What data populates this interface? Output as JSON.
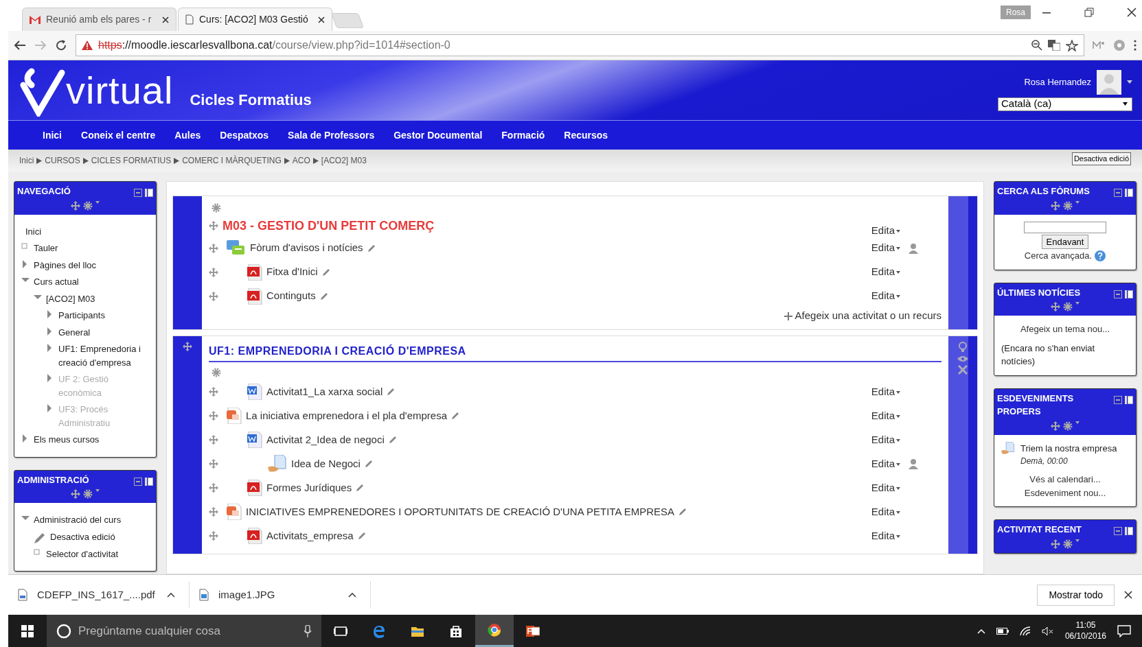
{
  "browser": {
    "tabs": [
      {
        "title": "Reunió amb els pares - r",
        "kind": "mail",
        "selected": false
      },
      {
        "title": "Curs: [ACO2] M03 Gestió",
        "kind": "page",
        "selected": true
      }
    ],
    "profile": "Rosa",
    "url_scheme": "https",
    "url_rest": "://moodle.iescarlesvallbona.cat",
    "url_path": "/course/view.php?id=1014#section-0"
  },
  "site": {
    "logo": "virtual",
    "subtitle": "Cicles Formatius",
    "user": "Rosa Hernandez",
    "language": "Català (ca)",
    "menu": [
      "Inici",
      "Coneix el centre",
      "Aules",
      "Despatxos",
      "Sala de Professors",
      "Gestor Documental",
      "Formació",
      "Recursos"
    ],
    "breadcrumb": [
      "Inici",
      "CURSOS",
      "CICLES FORMATIUS",
      "COMERC I MÀRQUETING",
      "ACO",
      "[ACO2] M03"
    ],
    "edit_button": "Desactiva edició"
  },
  "left_blocks": [
    {
      "title": "NAVEGACIÓ",
      "items": [
        {
          "label": "Inici",
          "kind": "home",
          "dimmed": false
        },
        {
          "label": "Tauler",
          "kind": "leaf",
          "dimmed": false
        },
        {
          "label": "Pàgines del lloc",
          "kind": "branch",
          "expanded": false,
          "dimmed": false
        },
        {
          "label": "Curs actual",
          "kind": "branch",
          "expanded": true,
          "dimmed": false,
          "children": [
            {
              "label": "[ACO2] M03",
              "kind": "branch",
              "expanded": true,
              "dimmed": false,
              "children": [
                {
                  "label": "Participants",
                  "kind": "branch",
                  "expanded": false,
                  "dimmed": false
                },
                {
                  "label": "General",
                  "kind": "branch",
                  "expanded": false,
                  "dimmed": false
                },
                {
                  "label": "UF1: Emprenedoria i creació d'empresa",
                  "kind": "branch",
                  "expanded": false,
                  "dimmed": false
                },
                {
                  "label": "UF 2: Gestió econòmica",
                  "kind": "branch",
                  "expanded": false,
                  "dimmed": true
                },
                {
                  "label": "UF3: Procés Administratiu",
                  "kind": "branch",
                  "expanded": false,
                  "dimmed": true
                }
              ]
            }
          ]
        },
        {
          "label": "Els meus cursos",
          "kind": "branch",
          "expanded": false,
          "dimmed": false
        }
      ]
    },
    {
      "title": "ADMINISTRACIÓ",
      "items": [
        {
          "label": "Administració del curs",
          "kind": "branch",
          "expanded": true,
          "dimmed": false,
          "children": [
            {
              "label": "Desactiva edició",
              "kind": "edit",
              "dimmed": false
            },
            {
              "label": "Selector d'activitat",
              "kind": "leaf",
              "dimmed": false
            }
          ]
        }
      ]
    }
  ],
  "sections": [
    {
      "kind": "general",
      "title": "M03 - GESTIO D'UN PETIT COMERÇ",
      "title_action": "Edita",
      "add_link": "Afegeix una activitat o un recurs",
      "activities": [
        {
          "name": "Fòrum d'avisos i notícies",
          "kind": "forum",
          "action": "Edita",
          "groups": true,
          "indented": false,
          "children": [
            {
              "name": "Fitxa d'Inici",
              "kind": "pdf",
              "action": "Edita",
              "groups": false,
              "indented": false
            },
            {
              "name": "Continguts",
              "kind": "pdf",
              "action": "Edita",
              "groups": false,
              "indented": false
            }
          ]
        }
      ]
    },
    {
      "kind": "topic",
      "title": "UF1: EMPRENEDORIA I CREACIÓ D'EMPRESA",
      "activities": [
        {
          "name": "Activitat1_La xarxa social",
          "kind": "word",
          "action": "Edita",
          "groups": false,
          "indented": true
        },
        {
          "name": "La iniciativa emprenedora i el pla d'empresa",
          "kind": "powerpoint",
          "action": "Edita",
          "groups": false,
          "indented": false,
          "children": [
            {
              "name": "Activitat 2_Idea de negoci",
              "kind": "word",
              "action": "Edita",
              "groups": false,
              "indented": false,
              "children": [
                {
                  "name": "Idea de Negoci",
                  "kind": "assign",
                  "action": "Edita",
                  "groups": true,
                  "indented": false
                }
              ]
            },
            {
              "name": "Formes Jurídiques",
              "kind": "pdf",
              "action": "Edita",
              "groups": false,
              "indented": false
            }
          ]
        },
        {
          "name": "INICIATIVES EMPRENEDORES I OPORTUNITATS DE CREACIÓ D'UNA PETITA EMPRESA",
          "kind": "powerpoint",
          "action": "Edita",
          "groups": false,
          "indented": false,
          "children": [
            {
              "name": "Activitats_empresa",
              "kind": "pdf",
              "action": "Edita",
              "groups": false,
              "indented": false
            }
          ]
        }
      ]
    }
  ],
  "right_blocks": [
    {
      "kind": "search",
      "title": "CERCA ALS FÒRUMS",
      "button": "Endavant",
      "link": "Cerca avançada."
    },
    {
      "kind": "news",
      "title": "ÚLTIMES NOTÍCIES",
      "link": "Afegeix un tema nou...",
      "text": "(Encara no s'han enviat notícies)"
    },
    {
      "kind": "events",
      "title": "ESDEVENIMENTS PROPERS",
      "event": "Triem la nostra empresa",
      "time": "Demà, 00:00",
      "links": [
        "Vés al calendari...",
        "Esdeveniment nou..."
      ]
    },
    {
      "kind": "recent",
      "title": "ACTIVITAT RECENT"
    }
  ],
  "downloads": {
    "items": [
      {
        "name": "CDEFP_INS_1617_....pdf",
        "kind": "pdf"
      },
      {
        "name": "image1.JPG",
        "kind": "image"
      }
    ],
    "show_all": "Mostrar todo"
  },
  "taskbar": {
    "search_placeholder": "Pregúntame cualquier cosa",
    "apps": [
      {
        "kind": "taskview",
        "selected": false
      },
      {
        "kind": "edge",
        "selected": false
      },
      {
        "kind": "explorer",
        "selected": false
      },
      {
        "kind": "store",
        "selected": false
      },
      {
        "kind": "chrome",
        "selected": true
      },
      {
        "kind": "powerpoint",
        "selected": false
      }
    ],
    "time": "11:05",
    "date": "06/10/2016"
  }
}
